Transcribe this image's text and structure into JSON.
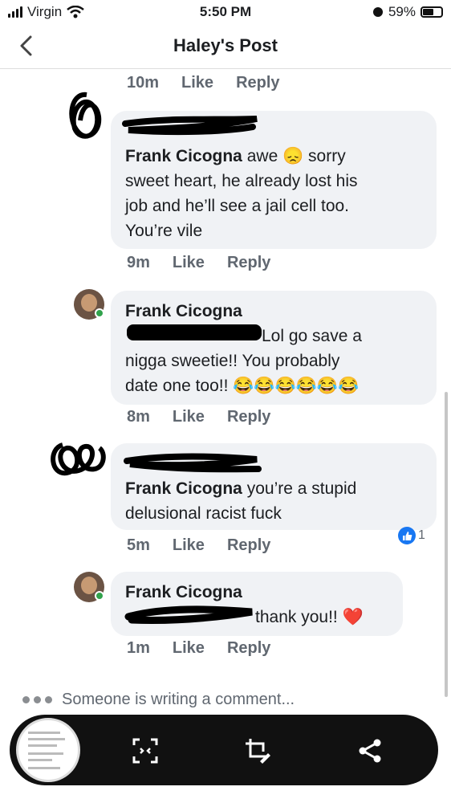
{
  "status_bar": {
    "carrier": "Virgin",
    "time": "5:50 PM",
    "battery": "59%",
    "battery_level": 0.59
  },
  "header": {
    "title": "Haley's Post"
  },
  "actions": {
    "like": "Like",
    "reply": "Reply"
  },
  "comments": [
    {
      "time": "10m"
    },
    {
      "author": "Frank Cicogna",
      "lines": [
        "awe 😞 sorry",
        "sweet heart, he already lost his",
        "job and he’ll see a jail cell too.",
        "You’re vile"
      ],
      "time": "9m"
    },
    {
      "author": "Frank Cicogna",
      "lines": [
        "Lol go save a",
        "nigga sweetie!! You probably",
        "date one too!! 😂😂😂😂😂😂"
      ],
      "time": "8m"
    },
    {
      "author": "Frank Cicogna",
      "lines": [
        "you’re a stupid",
        "delusional racist fuck"
      ],
      "time": "5m",
      "reactions": "1"
    },
    {
      "author": "Frank Cicogna",
      "lines": [
        "thank you!! ❤️"
      ],
      "time": "1m"
    }
  ],
  "typing": {
    "text": "Someone is writing a comment..."
  },
  "colors": {
    "online": "#31a24c",
    "like_blue": "#1877f2",
    "bubble": "#f0f2f5",
    "meta": "#606770"
  },
  "icons": [
    "back-chevron",
    "scan",
    "crop-edit",
    "share"
  ]
}
